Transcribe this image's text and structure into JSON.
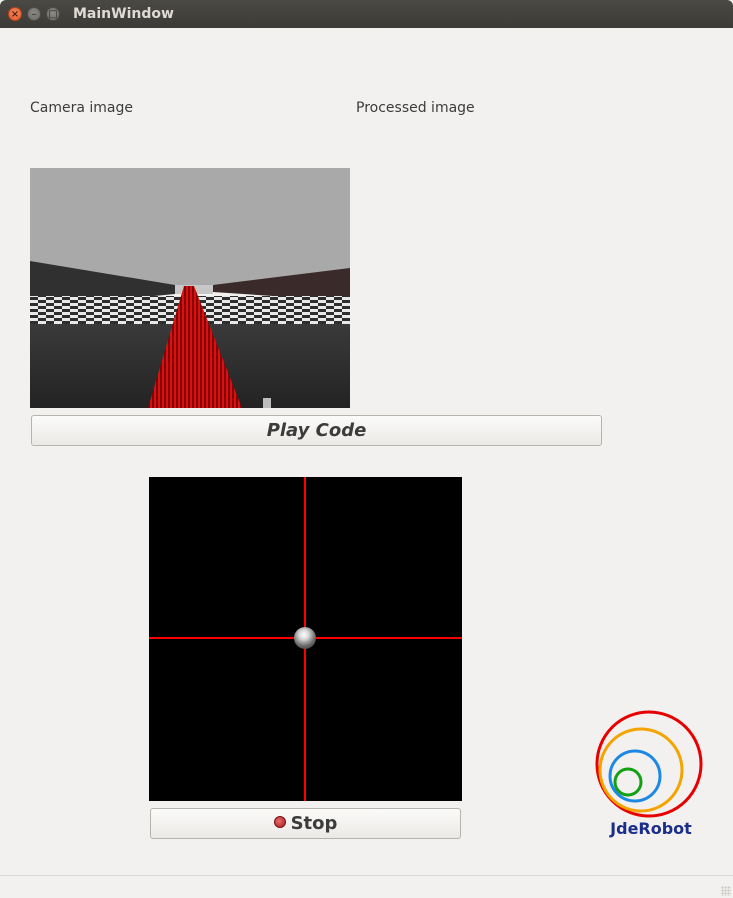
{
  "window": {
    "title": "MainWindow",
    "close_glyph": "×",
    "minimize_glyph": "–",
    "maximize_glyph": "□"
  },
  "labels": {
    "camera": "Camera image",
    "processed": "Processed image"
  },
  "buttons": {
    "play": "Play Code",
    "stop": "Stop"
  },
  "teleop": {
    "x": 0.0,
    "y": 0.0
  },
  "logo": {
    "text": "JdeRobot"
  },
  "colors": {
    "titlebar": "#3c3b37",
    "crosshair": "#ff0000",
    "teleop_bg": "#000000",
    "logo_text": "#1a2e8a",
    "window_bg": "#f2f1f0"
  },
  "icons": {
    "stop": "stop-record-icon",
    "close": "close-icon",
    "minimize": "minimize-icon",
    "maximize": "maximize-icon"
  }
}
